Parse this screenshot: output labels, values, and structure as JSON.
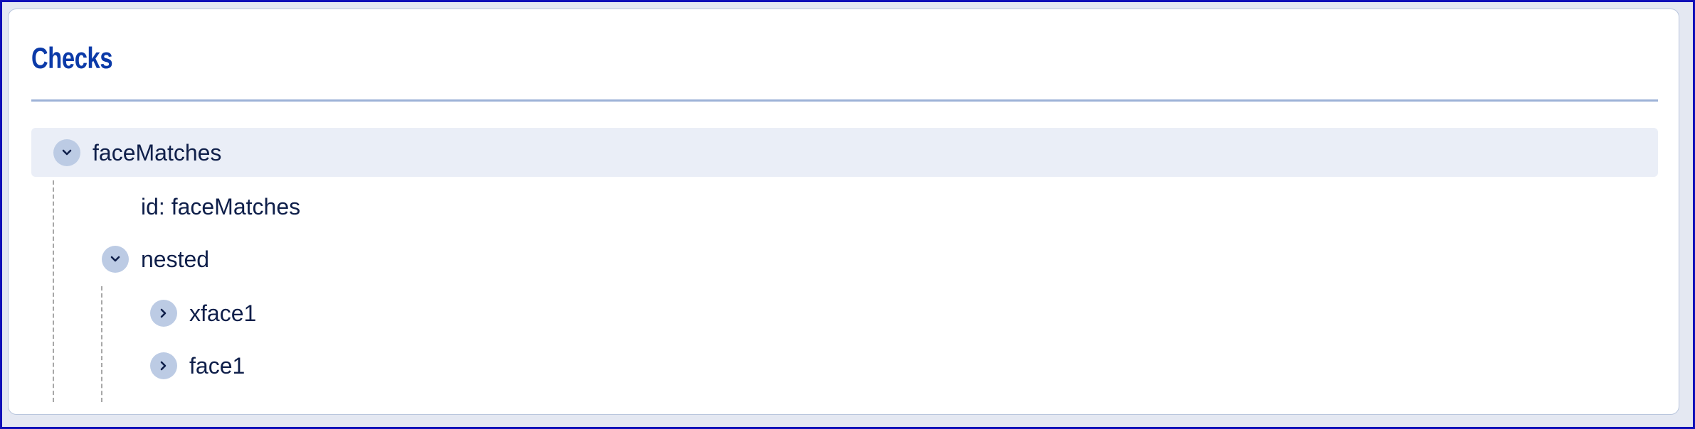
{
  "panel": {
    "title": "Checks"
  },
  "tree": {
    "root": {
      "label": "faceMatches",
      "expanded": true,
      "icon": "chevron-down-icon",
      "id_line": "id: faceMatches",
      "nested": {
        "label": "nested",
        "expanded": true,
        "icon": "chevron-down-icon",
        "children": [
          {
            "label": "xface1",
            "expanded": false,
            "icon": "chevron-right-icon"
          },
          {
            "label": "face1",
            "expanded": false,
            "icon": "chevron-right-icon"
          }
        ]
      }
    }
  },
  "colors": {
    "title": "#0b3aa8",
    "text": "#0f1f4a",
    "toggle_bg": "#bccbe4",
    "highlight_row": "#eaeef7",
    "divider": "#9db2d7",
    "outer_border": "#1010b8"
  }
}
